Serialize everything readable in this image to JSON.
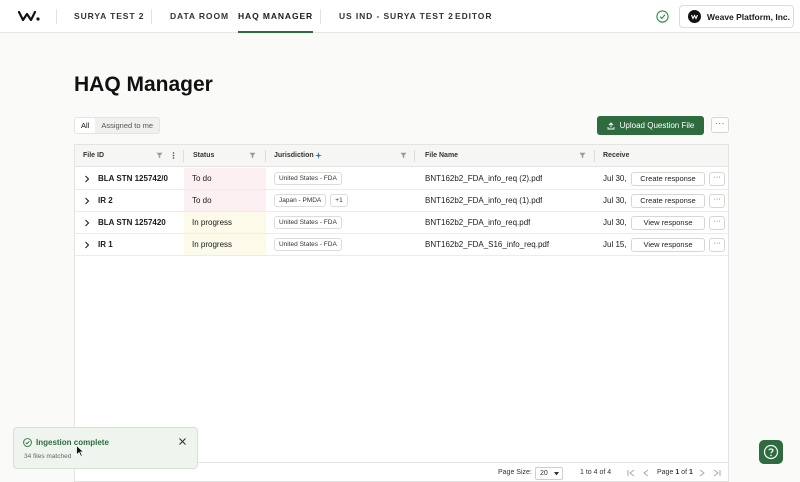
{
  "nav": {
    "project": "SURYA TEST 2",
    "items": [
      "DATA ROOM",
      "HAQ MANAGER"
    ],
    "context": "US IND - SURYA TEST 2",
    "editor": "EDITOR",
    "org": "Weave Platform, Inc."
  },
  "page": {
    "title": "HAQ Manager",
    "filters": [
      "All",
      "Assigned to me"
    ],
    "upload_label": "Upload Question File",
    "more_label": "···"
  },
  "table": {
    "headers": [
      "File ID",
      "Status",
      "Jurisdiction",
      "File Name",
      "Receive"
    ],
    "rows": [
      {
        "id": "BLA STN 125742/0",
        "status": "To do",
        "jurisdiction": "United States - FDA",
        "extra": "",
        "file": "BNT162b2_FDA_info_req (2).pdf",
        "received": "Jul 30,",
        "action": "Create response"
      },
      {
        "id": "IR 2",
        "status": "To do",
        "jurisdiction": "Japan - PMDA",
        "extra": "+1",
        "file": "BNT162b2_FDA_info_req (1).pdf",
        "received": "Jul 30,",
        "action": "Create response"
      },
      {
        "id": "BLA STN 1257420",
        "status": "In progress",
        "jurisdiction": "United States - FDA",
        "extra": "",
        "file": "BNT162b2_FDA_info_req.pdf",
        "received": "Jul 30,",
        "action": "View response"
      },
      {
        "id": "IR 1",
        "status": "In progress",
        "jurisdiction": "United States - FDA",
        "extra": "",
        "file": "BNT162b2_FDA_S16_info_req.pdf",
        "received": "Jul 15,",
        "action": "View response"
      }
    ],
    "footer": {
      "page_size_label": "Page Size:",
      "page_size": "20",
      "range": "1 to 4 of 4",
      "page_label": "Page",
      "page_current": "1",
      "page_of": "of",
      "page_total": "1"
    }
  },
  "toast": {
    "title": "Ingestion complete",
    "subtitle": "34 files matched"
  },
  "colors": {
    "brand": "#2e6b3f",
    "todo_bg": "#fdf0f2",
    "progress_bg": "#fcfbea"
  },
  "icons": {
    "logo": "weave-logo-icon",
    "status": "check-circle-icon",
    "help": "help-icon"
  }
}
